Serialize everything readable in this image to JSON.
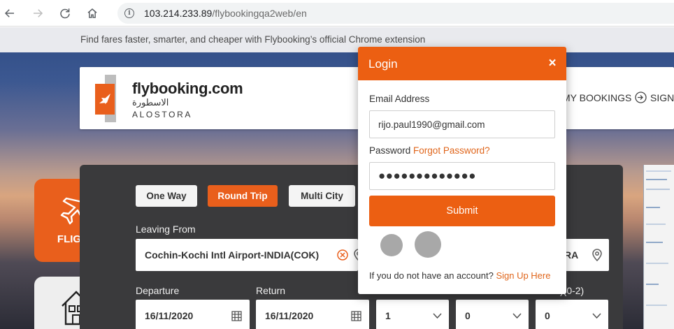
{
  "browser": {
    "url_host": "103.214.233.89",
    "url_path": "/flybookingqa2web/en",
    "info_glyph": "i",
    "icons": [
      "back-icon",
      "forward-icon",
      "reload-icon",
      "home-icon",
      "info-icon"
    ]
  },
  "banner": {
    "text": "Find fares faster, smarter, and cheaper with Flybooking’s official Chrome extension"
  },
  "header": {
    "logo_text": "flybooking.com",
    "logo_arabic": "الاسطورة",
    "logo_sub": "ALOSTORA",
    "nav": {
      "my_bookings": "MY BOOKINGS",
      "sign_in": "SIGN"
    }
  },
  "tiles": {
    "flight": "FLIGHT"
  },
  "search": {
    "trip_types": [
      "One Way",
      "Round Trip",
      "Multi City"
    ],
    "active_trip": "Round Trip",
    "leaving_label": "Leaving From",
    "leaving_value": "Cochin-Kochi Intl Airport-INDIA(COK)",
    "going_value_partial": "RA",
    "departure_label": "Departure",
    "departure_value": "16/11/2020",
    "return_label": "Return",
    "return_value": "16/11/2020",
    "adults_value": "1",
    "children_value": "0",
    "infants_label_partial": "s)(0-2)",
    "infants_value": "0"
  },
  "login": {
    "title": "Login",
    "close": "×",
    "email_label": "Email Address",
    "email_value": "rijo.paul1990@gmail.com",
    "password_label": "Password",
    "forgot_link": "Forgot Password?",
    "password_mask": "●●●●●●●●●●●●●",
    "submit_label": "Submit",
    "footer_text": "If you do not have an account?",
    "signup_link": "Sign Up Here"
  },
  "colors": {
    "accent": "#ec5f12",
    "panel": "#3a3a3c"
  }
}
